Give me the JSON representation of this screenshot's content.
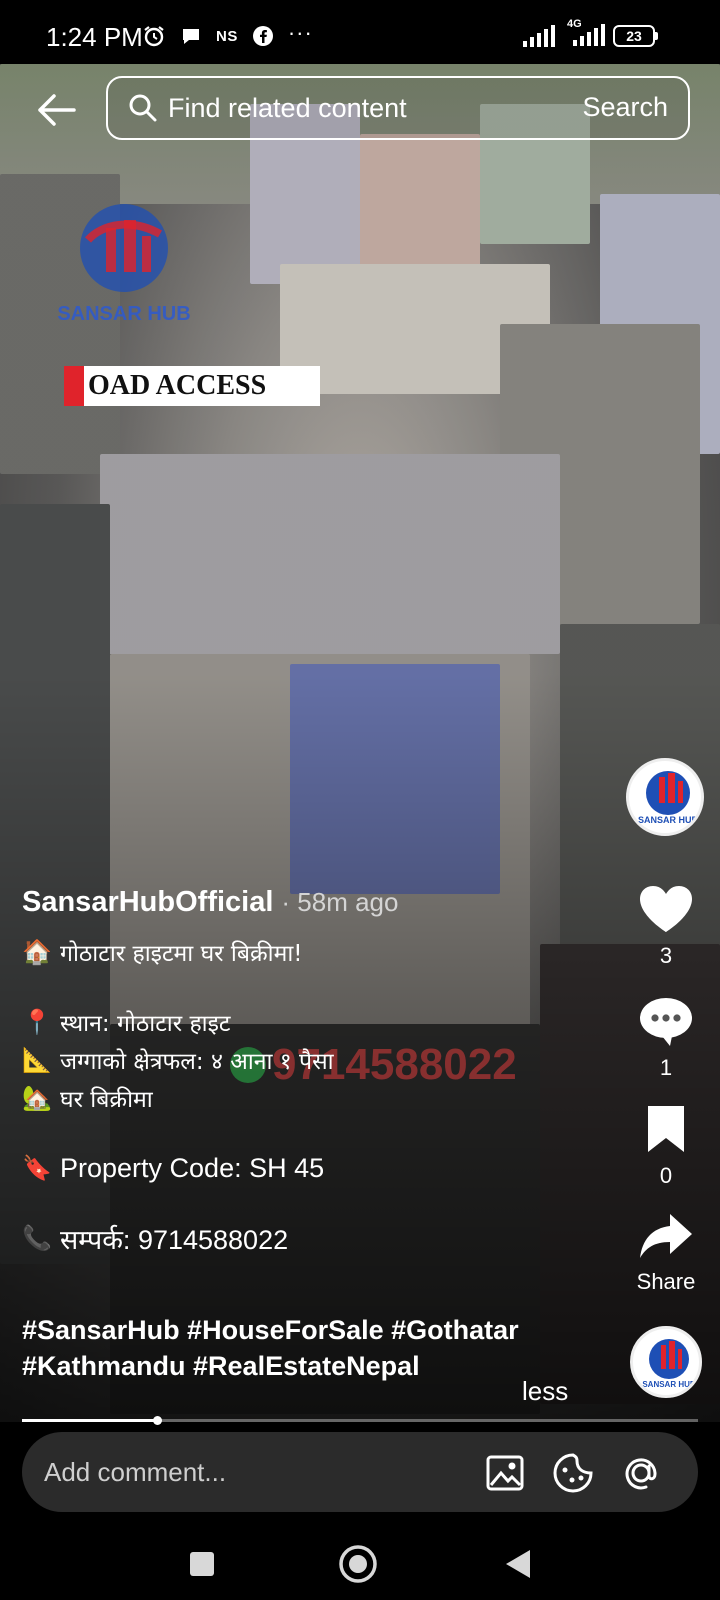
{
  "status_bar": {
    "time": "1:24 PM",
    "carrier_tag": "NS",
    "more": "···",
    "network": "4G",
    "battery": "23"
  },
  "search": {
    "placeholder": "Find related content",
    "button_label": "Search"
  },
  "video_overlay": {
    "logo_text": "SANSAR HUB",
    "road_tag": "OAD ACCESS",
    "phone_watermark": "9714588022"
  },
  "post": {
    "author": "SansarHubOfficial",
    "time_ago": "· 58m ago",
    "caption_lines": [
      {
        "emoji": "🏠",
        "text": "गोठाटार हाइटमा घर बिक्रीमा!"
      },
      {
        "emoji": "📍",
        "text": "स्थान: गोठाटार हाइट"
      },
      {
        "emoji": "📐",
        "text": "जग्गाको क्षेत्रफल: ४ आना १ पैसा"
      },
      {
        "emoji": "🏡",
        "text": "घर बिक्रीमा"
      },
      {
        "emoji": "🔖",
        "text": "Property Code: SH 45"
      },
      {
        "emoji": "📞",
        "text": "सम्पर्क: 9714588022"
      }
    ],
    "hashtags_line1": "#SansarHub #HouseForSale #Gothatar",
    "hashtags_line2": "#Kathmandu #RealEstateNepal",
    "less_label": "less",
    "progress_fraction": 0.2
  },
  "actions": {
    "avatar_label": "SANSAR HUB",
    "like_count": "3",
    "comment_count": "1",
    "save_count": "0",
    "share_label": "Share"
  },
  "comment": {
    "placeholder": "Add comment..."
  },
  "colors": {
    "brand_red": "#e0232b",
    "brand_blue": "#1e4fb5",
    "comment_box": "#2b2b2b"
  }
}
